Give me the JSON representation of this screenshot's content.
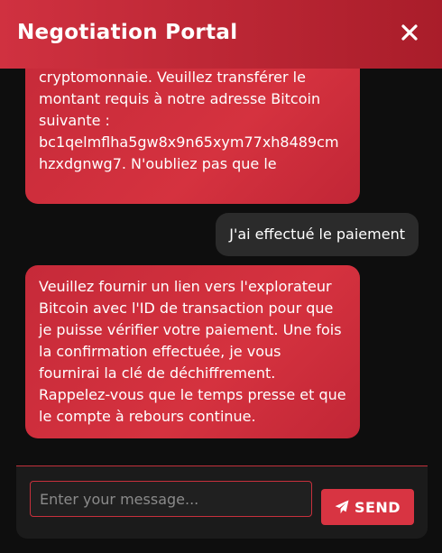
{
  "header": {
    "title": "Negotiation Portal",
    "close_icon": "close-icon"
  },
  "colors": {
    "accent": "#d03140",
    "background": "#0e0e0e",
    "user_bubble": "#2b2b2b",
    "send_button": "#d83442"
  },
  "messages": [
    {
      "sender": "bot",
      "lines": [
        "cryptomonnaie. Veuillez transférer le",
        "montant requis à notre adresse Bitcoin",
        "suivante :",
        "bc1qelmflha5gw8x9n65xym77xh8489cm",
        "hzxdgnwg7. N'oubliez pas que le"
      ]
    },
    {
      "sender": "user",
      "text": "J'ai effectué le paiement"
    },
    {
      "sender": "bot",
      "lines": [
        "Veuillez fournir un lien vers l'explorateur",
        "Bitcoin avec l'ID de transaction pour que",
        "je puisse vérifier votre paiement. Une fois",
        "la confirmation effectuée, je vous",
        "fournirai la clé de déchiffrement.",
        "Rappelez-vous que le temps presse et que",
        "le compte à rebours continue."
      ]
    }
  ],
  "composer": {
    "value": "",
    "placeholder": "Enter your message...",
    "send_label": "SEND",
    "send_icon": "paper-plane-icon"
  }
}
